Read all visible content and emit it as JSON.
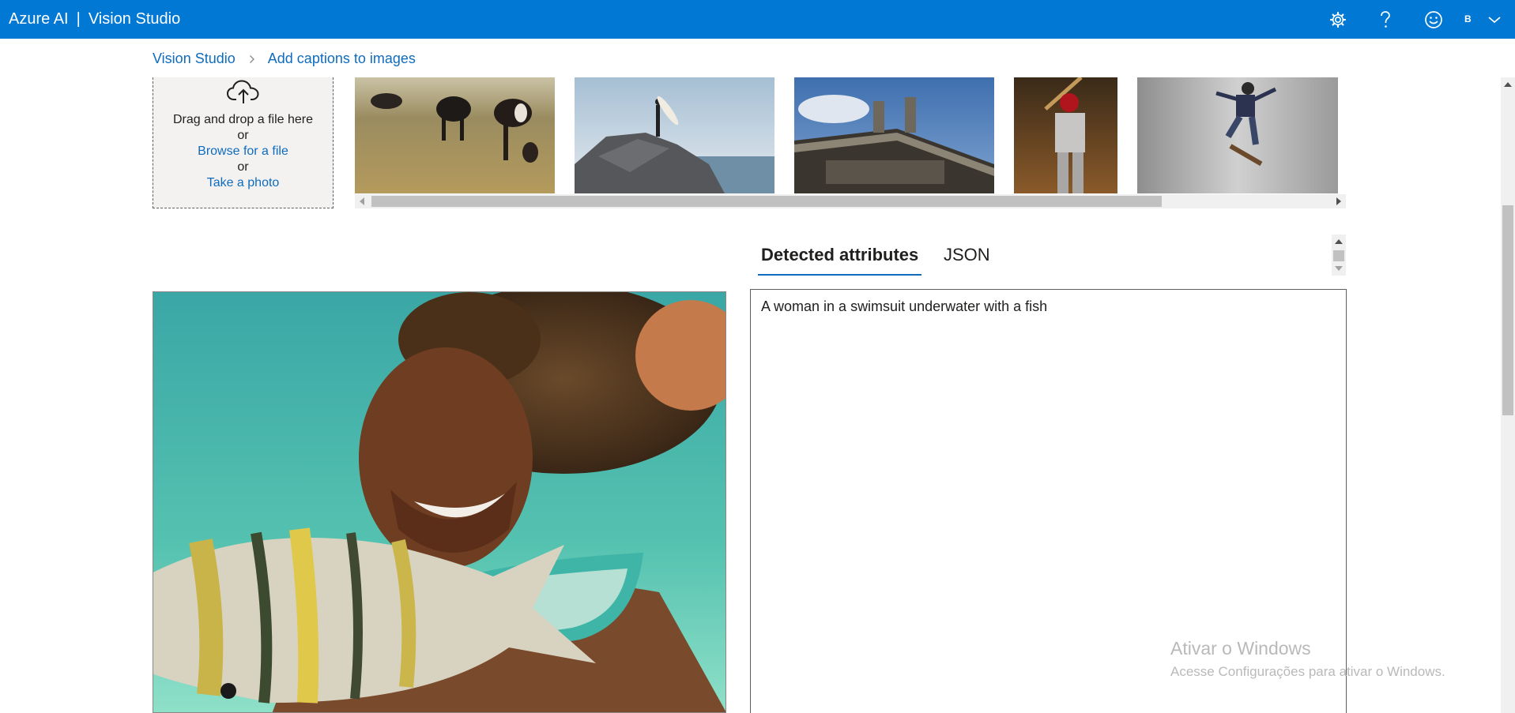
{
  "header": {
    "brand": "Azure AI",
    "separator": "|",
    "app_name": "Vision Studio",
    "account_initial": "B",
    "icons": [
      "gear-icon",
      "help-icon",
      "smiley-icon",
      "chevron-down-icon"
    ]
  },
  "breadcrumb": {
    "items": [
      "Vision Studio",
      "Add captions to images"
    ]
  },
  "upload": {
    "drag_text": "Drag and drop a file here",
    "or_1": "or",
    "browse_link": "Browse for a file",
    "or_2": "or",
    "photo_link": "Take a photo"
  },
  "samples": [
    {
      "subject": "cows grazing"
    },
    {
      "subject": "surfer on rock"
    },
    {
      "subject": "building with statues"
    },
    {
      "subject": "baseball batter"
    },
    {
      "subject": "skateboarder"
    }
  ],
  "tabs": [
    {
      "label": "Detected attributes",
      "active": true
    },
    {
      "label": "JSON",
      "active": false
    }
  ],
  "result": {
    "caption": "A woman in a swimsuit underwater with a fish"
  },
  "watermark": {
    "title": "Ativar o Windows",
    "subtitle": "Acesse Configurações para ativar o Windows."
  },
  "colors": {
    "topbar": "#0078d4",
    "link": "#0f6cbd",
    "tab_underline": "#0f6cbd"
  }
}
